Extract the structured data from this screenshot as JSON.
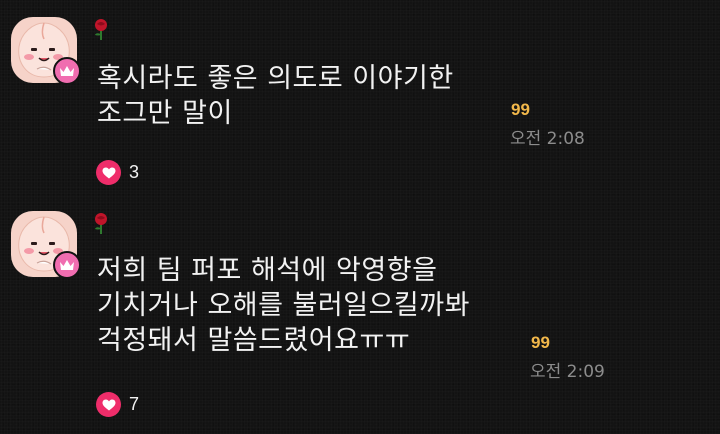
{
  "messages": [
    {
      "avatar_icon": "apeach-avatar-icon",
      "badge_icon": "crown-icon",
      "nickname_icon": "rose-icon",
      "text": "혹시라도 좋은 의도로 이야기한\n조그만 말이",
      "unread_count": "99",
      "time": "오전 2:08",
      "reaction_icon": "heart-icon",
      "reaction_count": "3"
    },
    {
      "avatar_icon": "apeach-avatar-icon",
      "badge_icon": "crown-icon",
      "nickname_icon": "rose-icon",
      "text": "저희 팀 퍼포 해석에 악영향을\n기치거나 오해를 불러일으킬까봐\n걱정돼서 말씀드렸어요ㅠㅠ",
      "unread_count": "99",
      "time": "오전 2:09",
      "reaction_icon": "heart-icon",
      "reaction_count": "7"
    }
  ],
  "colors": {
    "background": "#131313",
    "text": "#f2f2f2",
    "unread": "#f2b84b",
    "time": "#8c8c8c",
    "heart": "#ef2d6a",
    "badge": "#f06db0"
  }
}
